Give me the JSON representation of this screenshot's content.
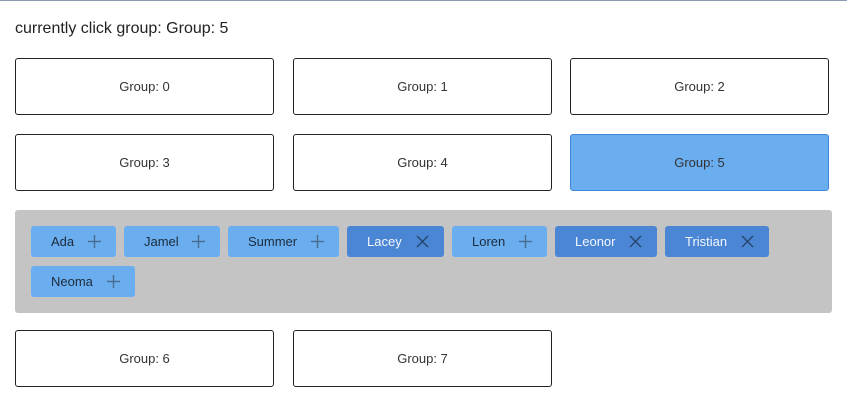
{
  "status_text": "currently click group: Group: 5",
  "groups": [
    {
      "label": "Group: 0",
      "active": false
    },
    {
      "label": "Group: 1",
      "active": false
    },
    {
      "label": "Group: 2",
      "active": false
    },
    {
      "label": "Group: 3",
      "active": false
    },
    {
      "label": "Group: 4",
      "active": false
    },
    {
      "label": "Group: 5",
      "active": true
    },
    {
      "label": "Group: 6",
      "active": false
    },
    {
      "label": "Group: 7",
      "active": false
    }
  ],
  "members": [
    {
      "name": "Ada",
      "in_group": false,
      "icon": "plus-icon"
    },
    {
      "name": "Jamel",
      "in_group": false,
      "icon": "plus-icon"
    },
    {
      "name": "Summer",
      "in_group": false,
      "icon": "plus-icon"
    },
    {
      "name": "Lacey",
      "in_group": true,
      "icon": "close-icon"
    },
    {
      "name": "Loren",
      "in_group": false,
      "icon": "plus-icon"
    },
    {
      "name": "Leonor",
      "in_group": true,
      "icon": "close-icon"
    },
    {
      "name": "Tristian",
      "in_group": true,
      "icon": "close-icon"
    },
    {
      "name": "Neoma",
      "in_group": false,
      "icon": "plus-icon"
    }
  ],
  "colors": {
    "active_group": "#6aaef0",
    "chip_add": "#6aaef0",
    "chip_remove": "#4a86d4",
    "panel_bg": "#c4c4c4"
  }
}
